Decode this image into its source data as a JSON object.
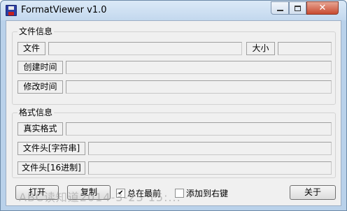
{
  "window": {
    "title": "FormatViewer v1.0",
    "close_symbol": "✕"
  },
  "file_info": {
    "group_title": "文件信息",
    "file_label": "文件",
    "file_value": "",
    "size_label": "大小",
    "size_value": "",
    "created_label": "创建时间",
    "created_value": "",
    "modified_label": "修改时间",
    "modified_value": ""
  },
  "format_info": {
    "group_title": "格式信息",
    "real_format_label": "真实格式",
    "real_format_value": "",
    "header_string_label": "文件头[字符串]",
    "header_string_value": "",
    "header_hex_label": "文件头[16进制]",
    "header_hex_value": ""
  },
  "bottom": {
    "open_label": "打开",
    "copy_label": "复制",
    "always_on_top_label": "总在最前",
    "always_on_top_checked": true,
    "context_menu_label": "添加到右键",
    "context_menu_checked": false,
    "about_label": "关于"
  },
  "watermark": "ABC读知道2014-3-23 15:..."
}
